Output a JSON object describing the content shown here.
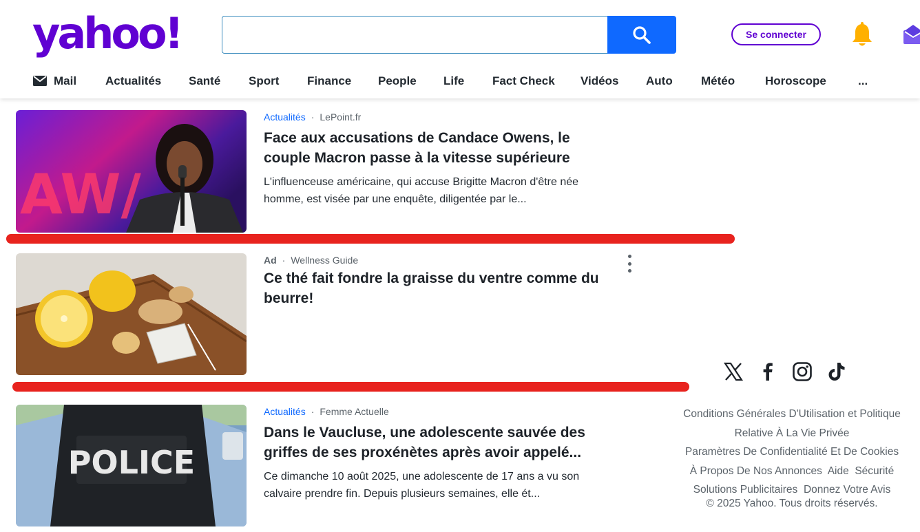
{
  "header": {
    "logo": "yahoo!",
    "search_placeholder": "",
    "signin_label": "Se connecter"
  },
  "nav": [
    {
      "label": "Mail",
      "icon": "mail-icon"
    },
    {
      "label": "Actualités"
    },
    {
      "label": "Santé"
    },
    {
      "label": "Sport"
    },
    {
      "label": "Finance"
    },
    {
      "label": "People"
    },
    {
      "label": "Life"
    },
    {
      "label": "Fact Check"
    },
    {
      "label": "Vidéos"
    },
    {
      "label": "Auto"
    },
    {
      "label": "Météo"
    },
    {
      "label": "Horoscope"
    },
    {
      "label": "..."
    }
  ],
  "stories": [
    {
      "category": "Actualités",
      "source": "LePoint.fr",
      "title": "Face aux accusations de Candace Owens, le couple Macron passe à la vitesse supérieure",
      "summary": "L'influenceuse américaine, qui accuse Brigitte Macron d'être née homme, est visée par une enquête, diligentée par le..."
    },
    {
      "ad_label": "Ad",
      "source": "Wellness Guide",
      "title": "Ce thé fait fondre la graisse du ventre comme du beurre!"
    },
    {
      "category": "Actualités",
      "source": "Femme Actuelle",
      "title": "Dans le Vaucluse, une adolescente sauvée des griffes de ses proxénètes après avoir appelé...",
      "summary": "Ce dimanche 10 août 2025, une adolescente de 17 ans a vu son calvaire prendre fin. Depuis plusieurs semaines, elle ét...",
      "image_text": "POLICE"
    }
  ],
  "social": [
    "x-icon",
    "facebook-icon",
    "instagram-icon",
    "tiktok-icon"
  ],
  "footer": {
    "links": [
      "Conditions Générales D'Utilisation et Politique Relative À La Vie Privée",
      "Paramètres De Confidentialité Et De Cookies",
      "À Propos De Nos Annonces",
      "Aide",
      "Sécurité",
      "Solutions Publicitaires",
      "Donnez Votre Avis"
    ],
    "copyright": "© 2025 Yahoo. Tous droits réservés."
  },
  "colors": {
    "brand": "#6001d2",
    "search_button": "#0f69ff",
    "category_link": "#0f69ff",
    "highlight_line": "#e8231e"
  }
}
